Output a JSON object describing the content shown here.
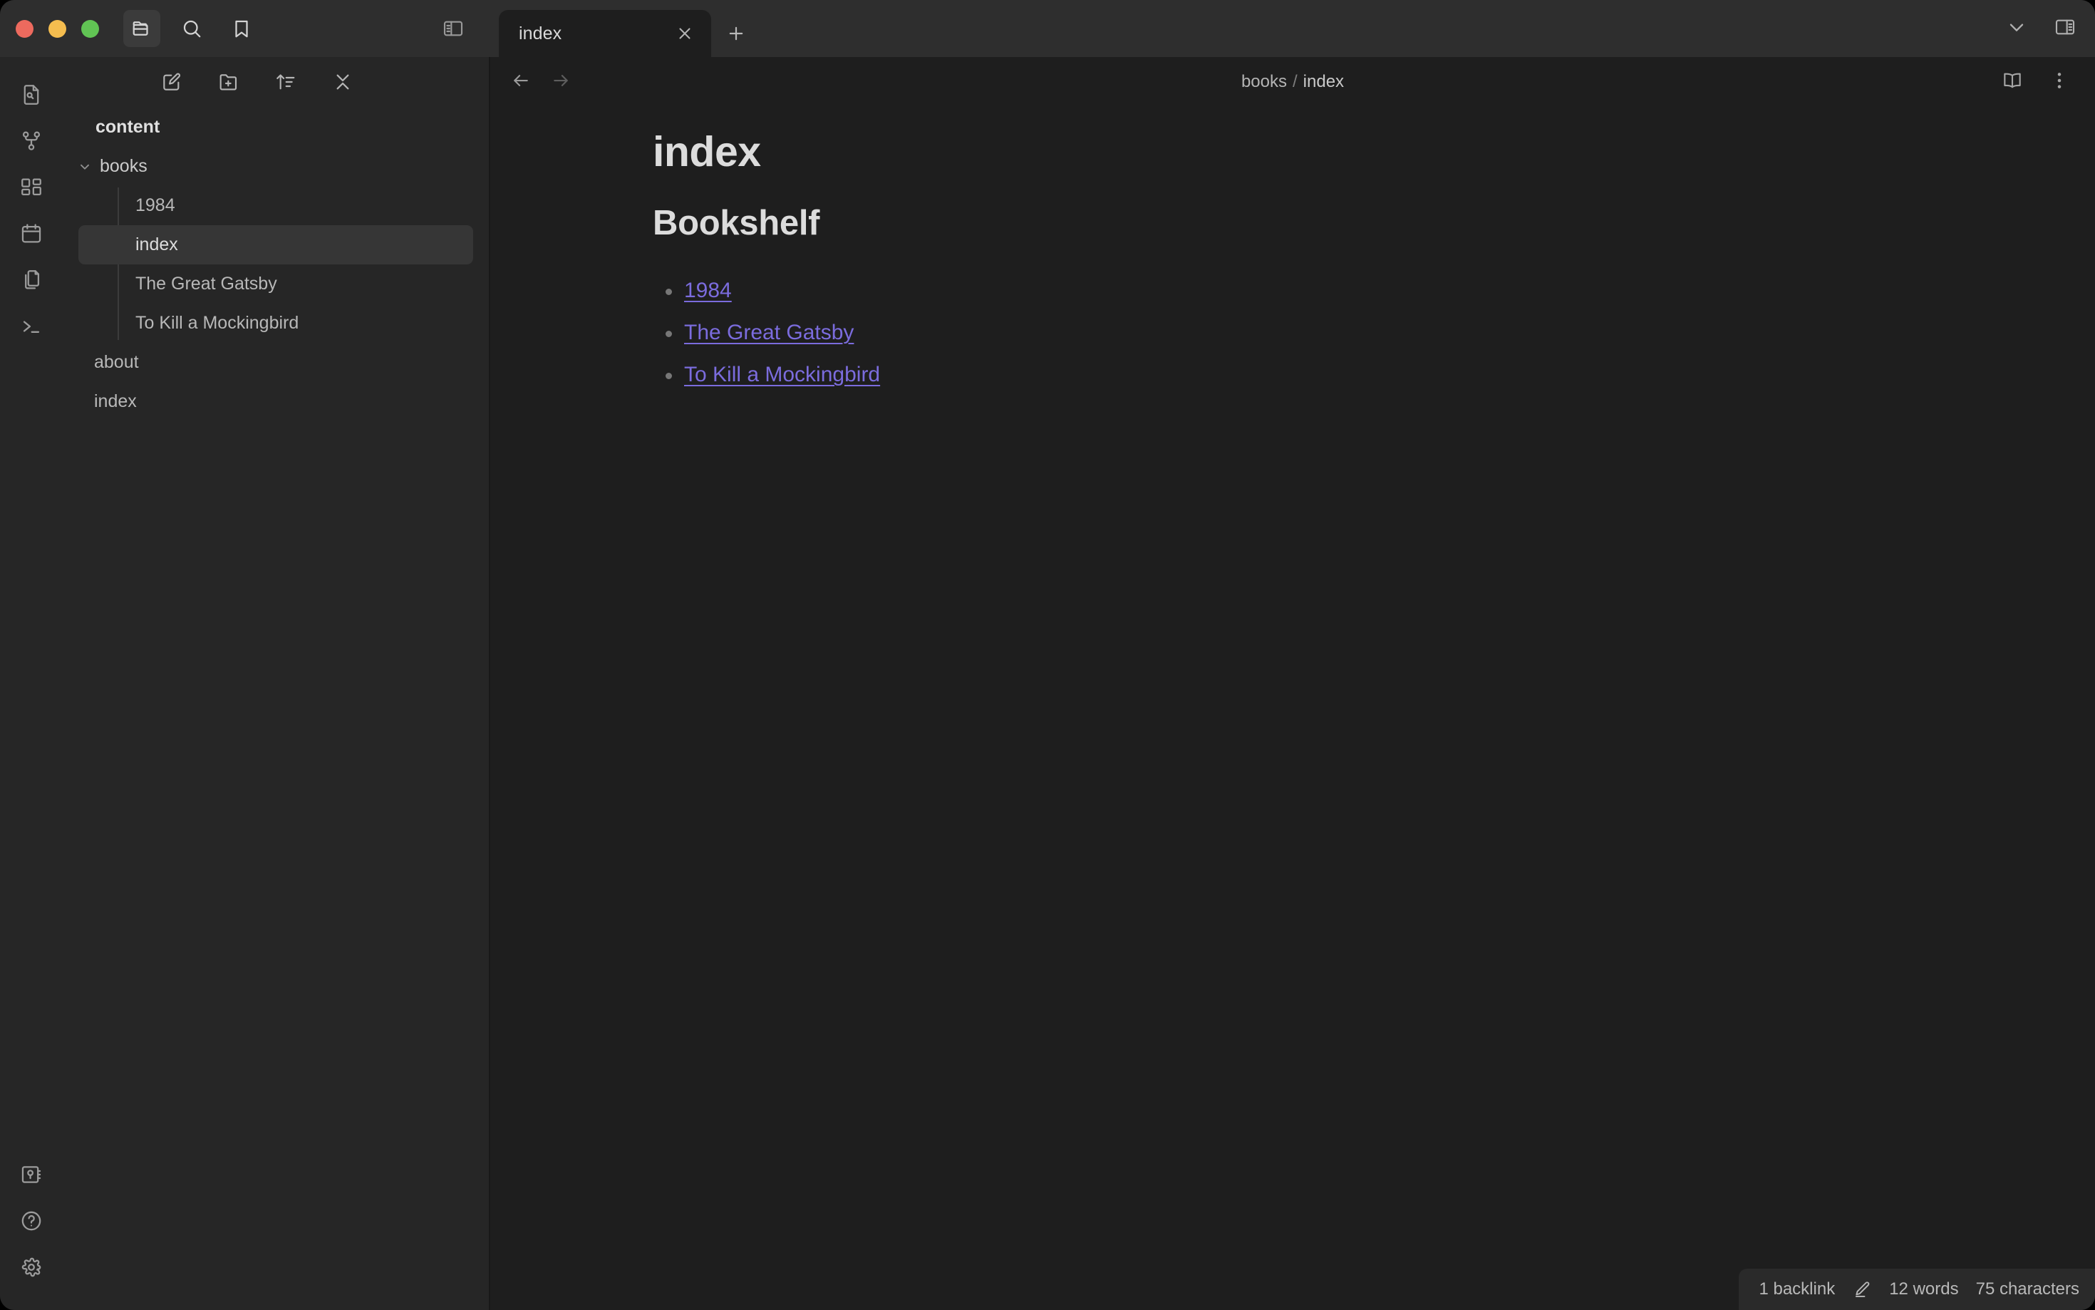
{
  "window": {
    "traffic_lights": {
      "close_color": "#ED6A5E",
      "minimize_color": "#F5BD4F",
      "maximize_color": "#61C454"
    }
  },
  "titlebar": {
    "icons": [
      {
        "name": "folder-icon",
        "label": "Files",
        "active": true
      },
      {
        "name": "search-icon",
        "label": "Search",
        "active": false
      },
      {
        "name": "bookmark-icon",
        "label": "Bookmarks",
        "active": false
      }
    ],
    "left_sidebar_toggle": "toggle-left-sidebar-icon",
    "dropdown": "chevron-down-icon",
    "right_sidebar_toggle": "toggle-right-sidebar-icon"
  },
  "tabs": {
    "items": [
      {
        "title": "index",
        "active": true
      }
    ],
    "close_label": "Close tab",
    "new_tab_label": "New tab"
  },
  "ribbon": {
    "top_items": [
      {
        "name": "quick-switcher-icon",
        "label": "Quick switcher"
      },
      {
        "name": "graph-view-icon",
        "label": "Graph view"
      },
      {
        "name": "canvas-icon",
        "label": "Canvas"
      },
      {
        "name": "daily-note-icon",
        "label": "Daily note"
      },
      {
        "name": "templates-icon",
        "label": "Insert template"
      },
      {
        "name": "terminal-icon",
        "label": "Command palette"
      }
    ],
    "bottom_items": [
      {
        "name": "vault-switcher-icon",
        "label": "Open another vault"
      },
      {
        "name": "help-icon",
        "label": "Help"
      },
      {
        "name": "settings-icon",
        "label": "Settings"
      }
    ]
  },
  "explorer": {
    "toolbar": [
      {
        "name": "new-note-icon",
        "label": "New note"
      },
      {
        "name": "new-folder-icon",
        "label": "New folder"
      },
      {
        "name": "sort-icon",
        "label": "Change sort order"
      },
      {
        "name": "collapse-all-icon",
        "label": "Collapse all"
      }
    ],
    "vault_name": "content",
    "tree": [
      {
        "label": "books",
        "type": "folder",
        "expanded": true,
        "children": [
          {
            "label": "1984",
            "type": "file",
            "selected": false
          },
          {
            "label": "index",
            "type": "file",
            "selected": true
          },
          {
            "label": "The Great Gatsby",
            "type": "file",
            "selected": false
          },
          {
            "label": "To Kill a Mockingbird",
            "type": "file",
            "selected": false
          }
        ]
      },
      {
        "label": "about",
        "type": "file",
        "selected": false
      },
      {
        "label": "index",
        "type": "file",
        "selected": false
      }
    ]
  },
  "view_header": {
    "back_label": "Navigate back",
    "forward_label": "Navigate forward",
    "breadcrumb": {
      "folder": "books",
      "separator": "/",
      "file": "index"
    },
    "actions": [
      {
        "name": "reading-view-icon",
        "label": "Current view: editing"
      },
      {
        "name": "more-options-icon",
        "label": "More options"
      }
    ]
  },
  "document": {
    "title": "index",
    "heading": "Bookshelf",
    "links": [
      "1984",
      "The Great Gatsby",
      "To Kill a Mockingbird"
    ],
    "link_color": "#7b6cdd"
  },
  "status_bar": {
    "backlinks": "1 backlink",
    "edit_icon": "pencil-icon",
    "words": "12 words",
    "characters": "75 characters"
  }
}
